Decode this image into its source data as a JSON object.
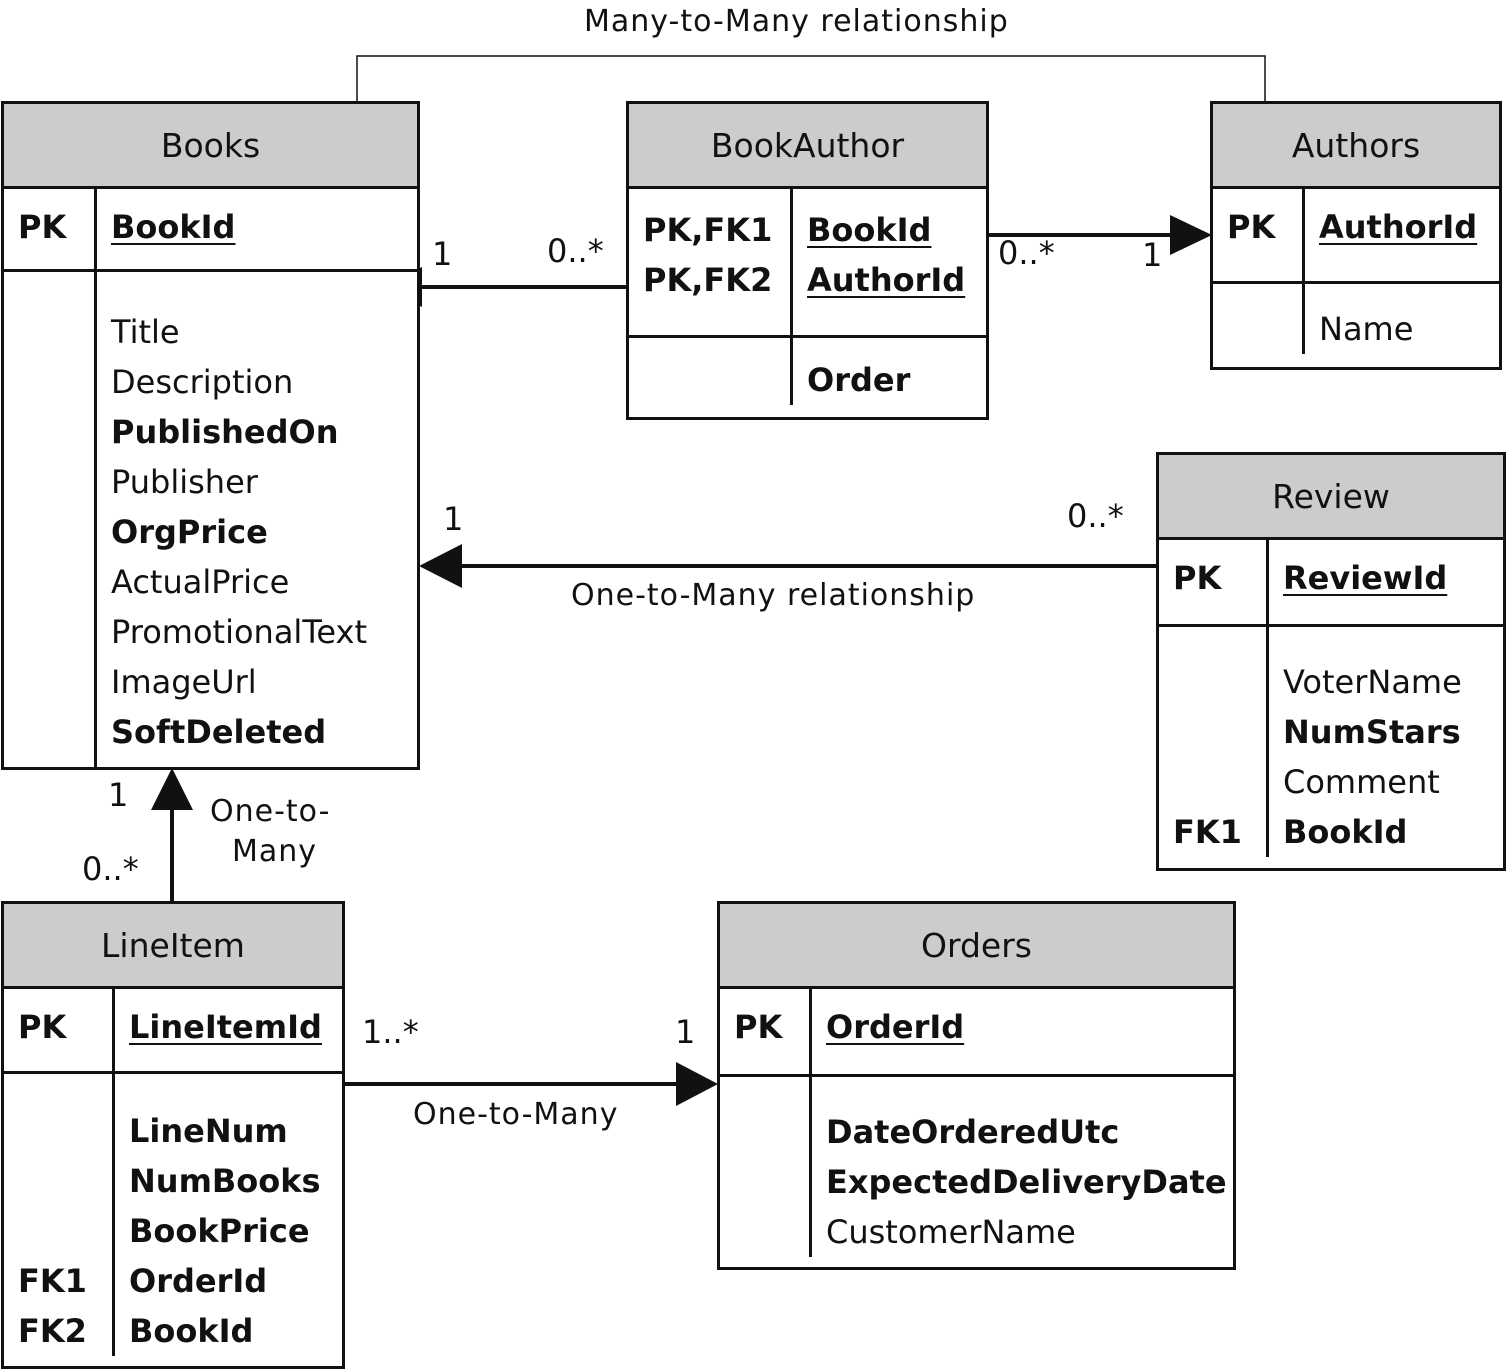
{
  "diagram": {
    "type": "entity-relationship",
    "entities": {
      "books": {
        "name": "Books",
        "pk": {
          "key": "PK",
          "field": "BookId"
        },
        "fields": [
          {
            "name": "Title",
            "bold": false
          },
          {
            "name": "Description",
            "bold": false
          },
          {
            "name": "PublishedOn",
            "bold": true
          },
          {
            "name": "Publisher",
            "bold": false
          },
          {
            "name": "OrgPrice",
            "bold": true
          },
          {
            "name": "ActualPrice",
            "bold": false
          },
          {
            "name": "PromotionalText",
            "bold": false
          },
          {
            "name": "ImageUrl",
            "bold": false
          },
          {
            "name": "SoftDeleted",
            "bold": true
          }
        ]
      },
      "bookauthor": {
        "name": "BookAuthor",
        "pk": [
          {
            "key": "PK,FK1",
            "field": "BookId"
          },
          {
            "key": "PK,FK2",
            "field": "AuthorId"
          }
        ],
        "fields": [
          {
            "name": "Order",
            "bold": true
          }
        ]
      },
      "authors": {
        "name": "Authors",
        "pk": {
          "key": "PK",
          "field": "AuthorId"
        },
        "fields": [
          {
            "name": "Name",
            "bold": false
          }
        ]
      },
      "review": {
        "name": "Review",
        "pk": {
          "key": "PK",
          "field": "ReviewId"
        },
        "fields": [
          {
            "key": "",
            "name": "VoterName",
            "bold": false
          },
          {
            "key": "",
            "name": "NumStars",
            "bold": true
          },
          {
            "key": "",
            "name": "Comment",
            "bold": false
          },
          {
            "key": "FK1",
            "name": "BookId",
            "bold": true
          }
        ]
      },
      "lineitem": {
        "name": "LineItem",
        "pk": {
          "key": "PK",
          "field": "LineItemId"
        },
        "fields": [
          {
            "key": "",
            "name": "LineNum",
            "bold": true
          },
          {
            "key": "",
            "name": "NumBooks",
            "bold": true
          },
          {
            "key": "",
            "name": "BookPrice",
            "bold": true
          },
          {
            "key": "FK1",
            "name": "OrderId",
            "bold": true
          },
          {
            "key": "FK2",
            "name": "BookId",
            "bold": true
          }
        ]
      },
      "orders": {
        "name": "Orders",
        "pk": {
          "key": "PK",
          "field": "OrderId"
        },
        "fields": [
          {
            "name": "DateOrderedUtc",
            "bold": true
          },
          {
            "name": "ExpectedDeliveryDate",
            "bold": true
          },
          {
            "name": "CustomerName",
            "bold": false
          }
        ]
      }
    },
    "relationships": {
      "many_to_many_label": "Many-to-Many relationship",
      "bookauthor_books": {
        "from": "BookAuthor",
        "to": "Books",
        "from_mult": "0..*",
        "to_mult": "1"
      },
      "bookauthor_authors": {
        "from": "BookAuthor",
        "to": "Authors",
        "from_mult": "0..*",
        "to_mult": "1"
      },
      "review_books": {
        "from": "Review",
        "to": "Books",
        "from_mult": "0..*",
        "to_mult": "1",
        "label": "One-to-Many relationship"
      },
      "lineitem_books": {
        "from": "LineItem",
        "to": "Books",
        "from_mult": "0..*",
        "to_mult": "1",
        "label_line1": "One-to-",
        "label_line2": "Many"
      },
      "lineitem_orders": {
        "from": "LineItem",
        "to": "Orders",
        "from_mult": "1..*",
        "to_mult": "1",
        "label": "One-to-Many"
      }
    }
  }
}
